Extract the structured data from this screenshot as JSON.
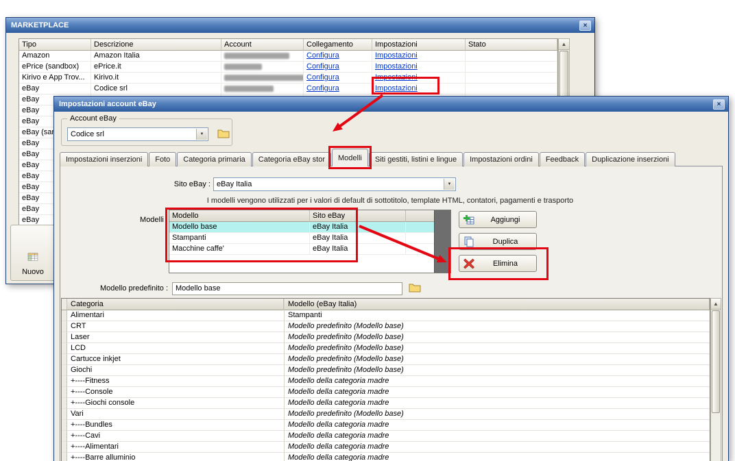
{
  "colors": {
    "annotation": "#e30613",
    "selection": "#b5f2ef",
    "link": "#0033cc"
  },
  "icons": {
    "close": "×",
    "dropdown": "▼",
    "scroll_up": "▲"
  },
  "marketplace": {
    "title": "MARKETPLACE",
    "columns": [
      "Tipo",
      "Descrizione",
      "Account",
      "Collegamento",
      "Impostazioni",
      "Stato"
    ],
    "rows": [
      {
        "tipo": "Amazon",
        "descrizione": "Amazon Italia",
        "collegamento": "Configura",
        "impostazioni": "Impostazioni",
        "stato": ""
      },
      {
        "tipo": "ePrice (sandbox)",
        "descrizione": "ePrice.it",
        "collegamento": "Configura",
        "impostazioni": "Impostazioni",
        "stato": ""
      },
      {
        "tipo": "Kirivo e App Trov...",
        "descrizione": "Kirivo.it",
        "collegamento": "Configura",
        "impostazioni": "Impostazioni",
        "stato": ""
      },
      {
        "tipo": "eBay",
        "descrizione": "Codice srl",
        "collegamento": "Configura",
        "impostazioni": "Impostazioni",
        "stato": ""
      }
    ],
    "partial_rows": [
      "eBay",
      "eBay",
      "eBay",
      "eBay (sandbox)",
      "eBay",
      "eBay",
      "eBay",
      "eBay",
      "eBay",
      "eBay",
      "eBay",
      "eBay"
    ],
    "nuovo_label": "Nuovo"
  },
  "dialog": {
    "title": "Impostazioni account eBay",
    "account_group_label": "Account eBay",
    "account_value": "Codice srl",
    "tabs": [
      {
        "label": "Impostazioni inserzioni"
      },
      {
        "label": "Foto"
      },
      {
        "label": "Categoria primaria"
      },
      {
        "label": "Categoria eBay stor"
      },
      {
        "label": "Modelli",
        "active": true,
        "annotated": true
      },
      {
        "label": "Siti gestiti, listini e lingue"
      },
      {
        "label": "Impostazioni ordini"
      },
      {
        "label": "Feedback"
      },
      {
        "label": "Duplicazione inserzioni"
      }
    ],
    "sito_label": "Sito eBay :",
    "sito_value": "eBay Italia",
    "info_text": "I modelli vengono utilizzati per i valori di default di sottotitolo, template HTML, contatori, pagamenti e trasporto",
    "modelli_label": "Modelli :",
    "modelli_table": {
      "columns": [
        "Modello",
        "Sito eBay"
      ],
      "rows": [
        {
          "modello": "Modello base",
          "sito": "eBay Italia",
          "selected": true
        },
        {
          "modello": "Stampanti",
          "sito": "eBay Italia",
          "selected": false
        },
        {
          "modello": "Macchine caffe'",
          "sito": "eBay Italia",
          "selected": false
        }
      ]
    },
    "buttons": [
      {
        "id": "aggiungi",
        "label": "Aggiungi",
        "icon": "add-table-icon"
      },
      {
        "id": "duplica",
        "label": "Duplica",
        "icon": "duplicate-icon"
      },
      {
        "id": "elimina",
        "label": "Elimina",
        "icon": "delete-icon",
        "annotated": true
      }
    ],
    "predefinito_label": "Modello predefinito :",
    "predefinito_value": "Modello base",
    "categoria_table": {
      "columns": [
        "Categoria",
        "Modello (eBay Italia)"
      ],
      "rows": [
        {
          "categoria": "Alimentari",
          "modello": "Stampanti",
          "italic": false
        },
        {
          "categoria": "CRT",
          "modello": "Modello predefinito (Modello base)",
          "italic": true
        },
        {
          "categoria": "Laser",
          "modello": "Modello predefinito (Modello base)",
          "italic": true
        },
        {
          "categoria": "LCD",
          "modello": "Modello predefinito (Modello base)",
          "italic": true
        },
        {
          "categoria": "Cartucce inkjet",
          "modello": "Modello predefinito (Modello base)",
          "italic": true
        },
        {
          "categoria": "Giochi",
          "modello": "Modello predefinito (Modello base)",
          "italic": true
        },
        {
          "categoria": "+----Fitness",
          "modello": "Modello della categoria madre",
          "italic": true
        },
        {
          "categoria": "+----Console",
          "modello": "Modello della categoria madre",
          "italic": true
        },
        {
          "categoria": "+----Giochi console",
          "modello": "Modello della categoria madre",
          "italic": true
        },
        {
          "categoria": "Vari",
          "modello": "Modello predefinito (Modello base)",
          "italic": true
        },
        {
          "categoria": "+----Bundles",
          "modello": "Modello della categoria madre",
          "italic": true
        },
        {
          "categoria": "+----Cavi",
          "modello": "Modello della categoria madre",
          "italic": true
        },
        {
          "categoria": "+----Alimentari",
          "modello": "Modello della categoria madre",
          "italic": true
        },
        {
          "categoria": "+----Barre alluminio",
          "modello": "Modello della categoria madre",
          "italic": true
        }
      ]
    }
  }
}
